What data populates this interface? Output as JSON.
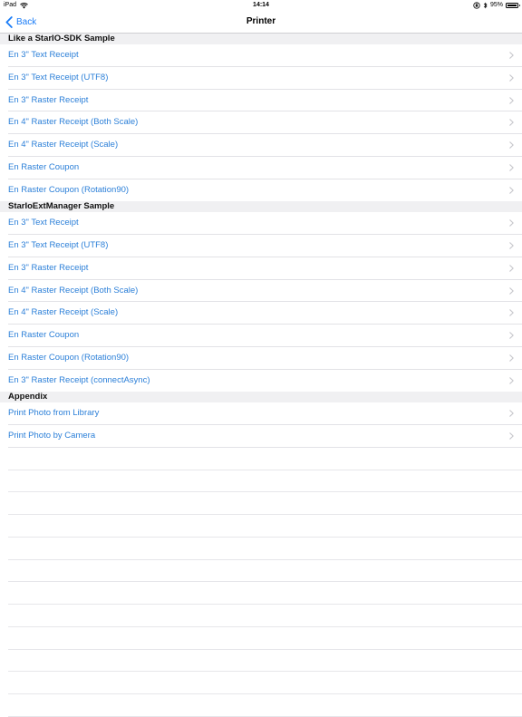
{
  "status_bar": {
    "device": "iPad",
    "time": "14:14",
    "battery": "95%",
    "battery_level": 0.95
  },
  "nav": {
    "back_label": "Back",
    "title": "Printer"
  },
  "sections": [
    {
      "title": "Like a StarIO-SDK Sample",
      "items": [
        "En 3\" Text Receipt",
        "En 3\" Text Receipt (UTF8)",
        "En 3\" Raster Receipt",
        "En 4\" Raster Receipt (Both Scale)",
        "En 4\" Raster Receipt (Scale)",
        "En Raster Coupon",
        "En Raster Coupon (Rotation90)"
      ]
    },
    {
      "title": "StarIoExtManager Sample",
      "items": [
        "En 3\" Text Receipt",
        "En 3\" Text Receipt (UTF8)",
        "En 3\" Raster Receipt",
        "En 4\" Raster Receipt (Both Scale)",
        "En 4\" Raster Receipt (Scale)",
        "En Raster Coupon",
        "En Raster Coupon (Rotation90)",
        "En 3\" Raster Receipt (connectAsync)"
      ]
    },
    {
      "title": "Appendix",
      "items": [
        "Print Photo from Library",
        "Print Photo by Camera"
      ]
    }
  ],
  "icons": {
    "back": "chevron-left-icon",
    "row": "chevron-right-icon",
    "wifi": "wifi-icon",
    "orientation_lock": "orientation-lock-icon",
    "bluetooth": "bluetooth-icon",
    "battery": "battery-icon"
  },
  "colors": {
    "accent": "#1a7cf7",
    "row_text": "#2b7fd8",
    "section_bg": "#f0f0f2",
    "chevron": "#c7c7cc"
  }
}
